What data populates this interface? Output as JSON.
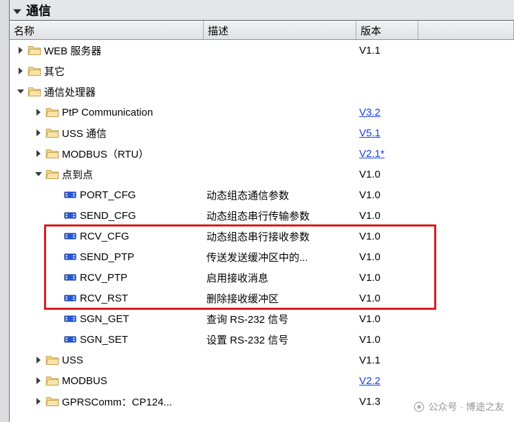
{
  "title": "通信",
  "columns": {
    "name": "名称",
    "desc": "描述",
    "ver": "版本"
  },
  "rows": [
    {
      "indent": 0,
      "exp": "closed",
      "icon": "folder",
      "name": "WEB 服务器",
      "desc": "",
      "ver": "V1.1",
      "link": false
    },
    {
      "indent": 0,
      "exp": "closed",
      "icon": "folder",
      "name": "其它",
      "desc": "",
      "ver": "",
      "link": false
    },
    {
      "indent": 0,
      "exp": "open",
      "icon": "folder",
      "name": "通信处理器",
      "desc": "",
      "ver": "",
      "link": false
    },
    {
      "indent": 1,
      "exp": "closed",
      "icon": "folder",
      "name": "PtP Communication",
      "desc": "",
      "ver": "V3.2",
      "link": true
    },
    {
      "indent": 1,
      "exp": "closed",
      "icon": "folder",
      "name": "USS 通信",
      "desc": "",
      "ver": "V5.1",
      "link": true
    },
    {
      "indent": 1,
      "exp": "closed",
      "icon": "folder",
      "name": "MODBUS（RTU）",
      "desc": "",
      "ver": "V2.1*",
      "link": true
    },
    {
      "indent": 1,
      "exp": "open",
      "icon": "folder",
      "name": "点到点",
      "desc": "",
      "ver": "V1.0",
      "link": false
    },
    {
      "indent": 2,
      "exp": "none",
      "icon": "block",
      "name": "PORT_CFG",
      "desc": "动态组态通信参数",
      "ver": "V1.0",
      "link": false
    },
    {
      "indent": 2,
      "exp": "none",
      "icon": "block",
      "name": "SEND_CFG",
      "desc": "动态组态串行传输参数",
      "ver": "V1.0",
      "link": false
    },
    {
      "indent": 2,
      "exp": "none",
      "icon": "block",
      "name": "RCV_CFG",
      "desc": "动态组态串行接收参数",
      "ver": "V1.0",
      "link": false
    },
    {
      "indent": 2,
      "exp": "none",
      "icon": "block",
      "name": "SEND_PTP",
      "desc": "传送发送缓冲区中的...",
      "ver": "V1.0",
      "link": false
    },
    {
      "indent": 2,
      "exp": "none",
      "icon": "block",
      "name": "RCV_PTP",
      "desc": "启用接收消息",
      "ver": "V1.0",
      "link": false
    },
    {
      "indent": 2,
      "exp": "none",
      "icon": "block",
      "name": "RCV_RST",
      "desc": "删除接收缓冲区",
      "ver": "V1.0",
      "link": false
    },
    {
      "indent": 2,
      "exp": "none",
      "icon": "block",
      "name": "SGN_GET",
      "desc": "查询 RS-232 信号",
      "ver": "V1.0",
      "link": false
    },
    {
      "indent": 2,
      "exp": "none",
      "icon": "block",
      "name": "SGN_SET",
      "desc": "设置 RS-232 信号",
      "ver": "V1.0",
      "link": false
    },
    {
      "indent": 1,
      "exp": "closed",
      "icon": "folder",
      "name": "USS",
      "desc": "",
      "ver": "V1.1",
      "link": false
    },
    {
      "indent": 1,
      "exp": "closed",
      "icon": "folder",
      "name": "MODBUS",
      "desc": "",
      "ver": "V2.2",
      "link": true
    },
    {
      "indent": 1,
      "exp": "closed",
      "icon": "folder",
      "name": "GPRSComm：CP124...",
      "desc": "",
      "ver": "V1.3",
      "link": false
    }
  ],
  "highlight": {
    "startRow": 9,
    "endRow": 12
  },
  "watermark": "公众号 · 博途之友"
}
